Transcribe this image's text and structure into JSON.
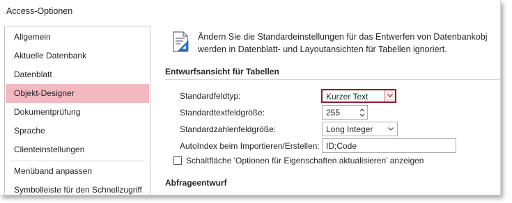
{
  "window": {
    "title": "Access-Optionen"
  },
  "sidebar": {
    "items": [
      {
        "label": "Allgemein"
      },
      {
        "label": "Aktuelle Datenbank"
      },
      {
        "label": "Datenblatt"
      },
      {
        "label": "Objekt-Designer",
        "selected": true
      },
      {
        "label": "Dokumentprüfung"
      },
      {
        "label": "Sprache"
      },
      {
        "label": "Clienteinstellungen"
      },
      {
        "label": "Menüband anpassen"
      },
      {
        "label": "Symbolleiste für den Schnellzugriff"
      }
    ]
  },
  "main": {
    "intro_line1": "Ändern Sie die Standardeinstellungen für das Entwerfen von Datenbankobj",
    "intro_line2": "werden in Datenblatt- und Layoutansichten für Tabellen ignoriert.",
    "section_table_design": "Entwurfsansicht für Tabellen",
    "fields": {
      "default_field_type": {
        "label": "Standardfeldtyp:",
        "value": "Kurzer Text"
      },
      "default_text_size": {
        "label": "Standardtextfeldgröße:",
        "value": "255"
      },
      "default_number_size": {
        "label": "Standardzahlenfeldgröße:",
        "value": "Long Integer"
      },
      "autoindex": {
        "label": "AutoIndex beim Importieren/Erstellen:",
        "value": "ID;Code"
      },
      "show_property_update_options": {
        "label": "Schaltfläche 'Optionen für Eigenschaften aktualisieren' anzeigen",
        "checked": false
      }
    },
    "section_query_design": "Abfrageentwurf"
  },
  "icons": {
    "intro": "form-design-icon",
    "dropdown": "chevron-down-icon",
    "spinner": "spin-arrows-icon"
  },
  "colors": {
    "selected_nav": "#f4b8c0",
    "accent_border": "#8a1c2c"
  }
}
